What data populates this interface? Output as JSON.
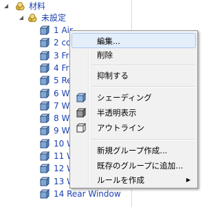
{
  "tree": {
    "root": {
      "label": "材料"
    },
    "group": {
      "label": "未設定"
    },
    "items": [
      {
        "label": "1 Air"
      },
      {
        "label": "2 co"
      },
      {
        "label": "3 Fro"
      },
      {
        "label": "4 Fro"
      },
      {
        "label": "5 Re"
      },
      {
        "label": "6 Wi"
      },
      {
        "label": "7 Wh"
      },
      {
        "label": "8 Wh"
      },
      {
        "label": "9 Wh"
      },
      {
        "label": "10 W"
      },
      {
        "label": "11 W"
      },
      {
        "label": "12 W"
      },
      {
        "label": "13 Window R1"
      },
      {
        "label": "14 Rear Window"
      }
    ]
  },
  "context_menu": {
    "edit": "編集...",
    "delete": "削除",
    "suppress": "抑制する",
    "shading": "シェーディング",
    "translucent": "半透明表示",
    "outline": "アウトライン",
    "new_group": "新規グループ作成...",
    "add_to_group": "既存のグループに追加...",
    "create_rule": "ルールを作成",
    "submenu_arrow": "▶"
  },
  "colors": {
    "item_text": "#1a3fae",
    "menu_bg": "#f1f1f1",
    "highlight": "#e4eefb"
  }
}
